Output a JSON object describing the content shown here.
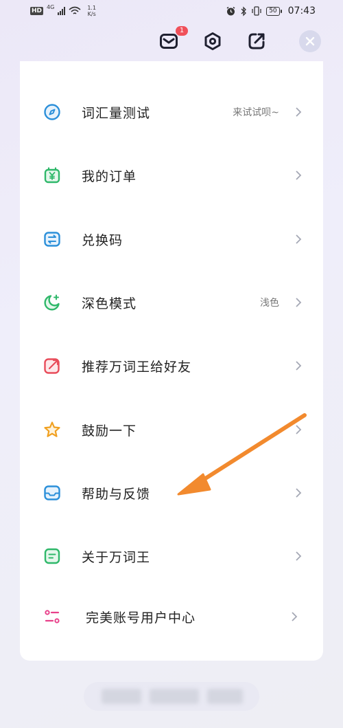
{
  "status_bar": {
    "hd": "HD",
    "network": "4G",
    "speed_value": "1.1",
    "speed_unit": "K/s",
    "battery": "50",
    "time": "07:43"
  },
  "header": {
    "mail_badge": "1"
  },
  "menu": {
    "items": [
      {
        "label": "词汇量测试",
        "hint": "来试试呗~",
        "icon": "target-icon",
        "color": "#2b8fd9"
      },
      {
        "label": "我的订单",
        "hint": "",
        "icon": "yuan-bag-icon",
        "color": "#2fb86a"
      },
      {
        "label": "兑换码",
        "hint": "",
        "icon": "exchange-icon",
        "color": "#2b8fd9"
      },
      {
        "label": "深色模式",
        "hint": "浅色",
        "icon": "moon-icon",
        "color": "#2fb86a"
      },
      {
        "label": "推荐万词王给好友",
        "hint": "",
        "icon": "share-icon",
        "color": "#e84c5a"
      },
      {
        "label": "鼓励一下",
        "hint": "",
        "icon": "star-icon",
        "color": "#f0a020"
      },
      {
        "label": "帮助与反馈",
        "hint": "",
        "icon": "inbox-icon",
        "color": "#2b8fd9"
      },
      {
        "label": "关于万词王",
        "hint": "",
        "icon": "document-icon",
        "color": "#2fb86a"
      },
      {
        "label": "完美账号用户中心",
        "hint": "",
        "icon": "account-sliders-icon",
        "color": "#e8408a"
      }
    ]
  },
  "colors": {
    "arrow": "#f28a2e",
    "badge": "#f0505a"
  }
}
